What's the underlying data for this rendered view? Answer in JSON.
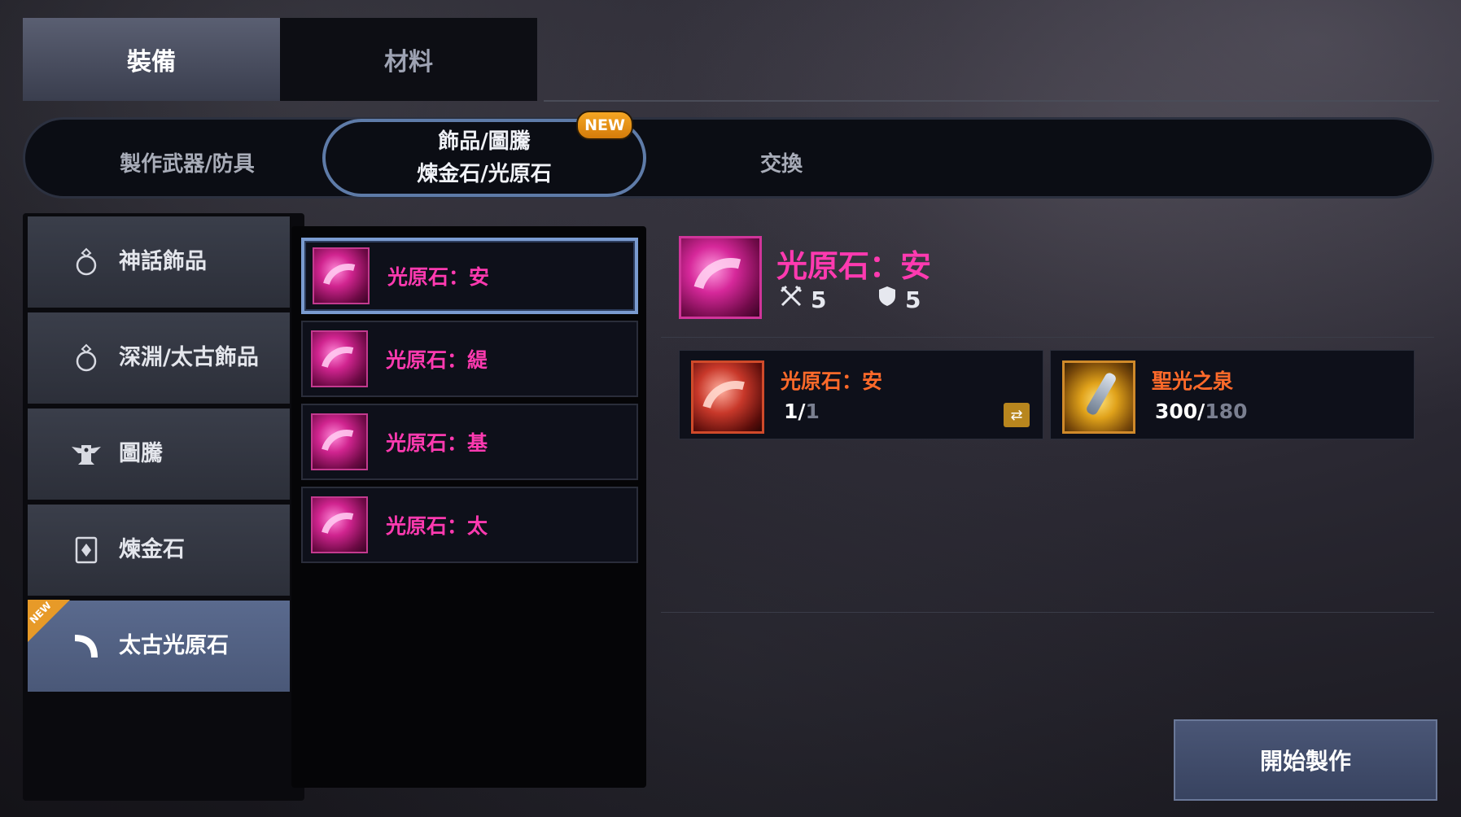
{
  "top_tabs": [
    {
      "label": "裝備"
    },
    {
      "label": "材料"
    }
  ],
  "sub_tabs": {
    "craft": "製作武器/防具",
    "accessory_line1": "飾品/圖騰",
    "accessory_line2": "煉金石/光原石",
    "exchange": "交換",
    "new_badge": "NEW"
  },
  "categories": [
    {
      "label": "神話飾品",
      "icon": "ring-icon"
    },
    {
      "label": "深淵/太古飾品",
      "icon": "ring-icon"
    },
    {
      "label": "圖騰",
      "icon": "totem-icon"
    },
    {
      "label": "煉金石",
      "icon": "alchemy-stone-icon"
    },
    {
      "label": "太古光原石",
      "icon": "light-stone-icon",
      "new_tag": "NEW"
    }
  ],
  "items": [
    {
      "name": "光原石：安"
    },
    {
      "name": "光原石：緹"
    },
    {
      "name": "光原石：基"
    },
    {
      "name": "光原石：太"
    }
  ],
  "detail": {
    "title": "光原石：安",
    "attack": "5",
    "defense": "5"
  },
  "materials": [
    {
      "name": "光原石：安",
      "owned": "1/",
      "required": "1"
    },
    {
      "name": "聖光之泉",
      "owned": "300/",
      "required": "180"
    }
  ],
  "actions": {
    "start": "開始製作"
  },
  "colors": {
    "item_name": "#ff3ab0",
    "material_name": "#ff6a2a",
    "new_badge": "#f5a623"
  }
}
